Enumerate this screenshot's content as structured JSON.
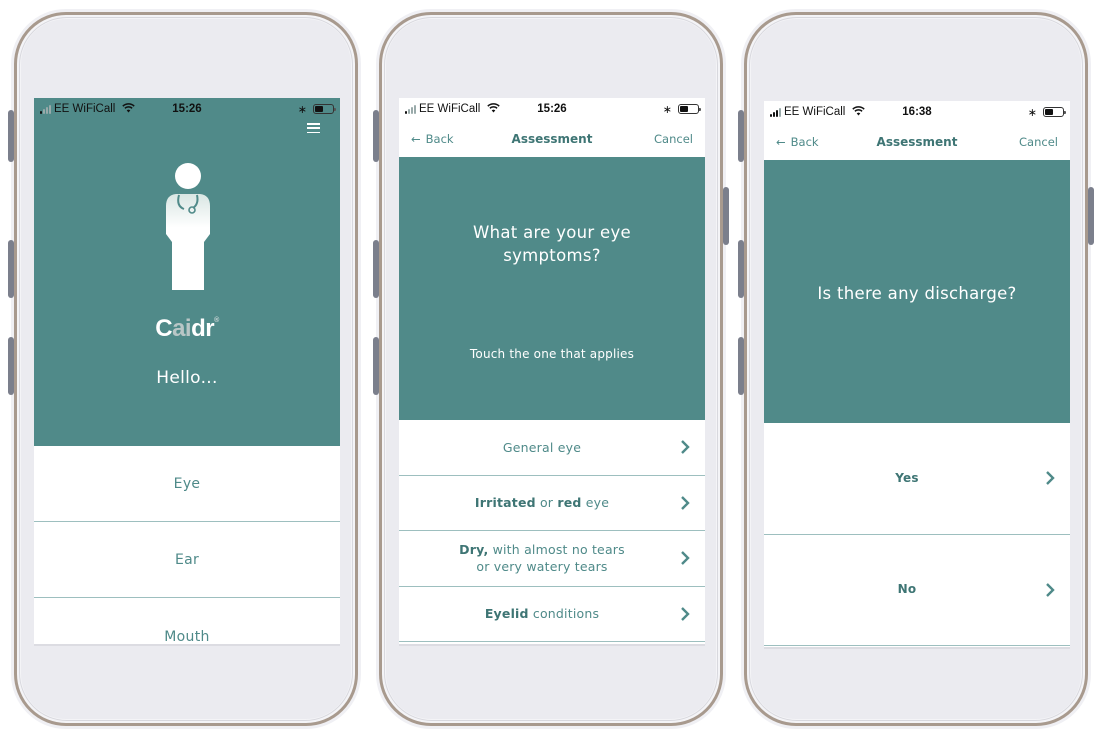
{
  "colors": {
    "teal": "#508a89",
    "teal_text": "#4f8a89",
    "divider": "#9dbfbf"
  },
  "phones": [
    {
      "status": {
        "carrier": "EE WiFiCall",
        "time": "15:26",
        "signal_bars_on": 1
      },
      "menu_icon": "hamburger-icon",
      "hero": {
        "illustration": "doctor-icon",
        "logo_prefix": "C",
        "logo_ai": "ai",
        "logo_suffix": "dr",
        "logo_mark": "®",
        "greeting": "Hello..."
      },
      "list": [
        {
          "label": "Eye"
        },
        {
          "label": "Ear"
        },
        {
          "label": "Mouth"
        }
      ]
    },
    {
      "status": {
        "carrier": "EE WiFiCall",
        "time": "15:26",
        "signal_bars_on": 1
      },
      "nav": {
        "back_arrow": "←",
        "back": "Back",
        "title": "Assessment",
        "cancel": "Cancel"
      },
      "question": {
        "title": "What are your eye symptoms?",
        "subtitle": "Touch the one that applies"
      },
      "options": [
        {
          "parts": [
            {
              "t": "General eye",
              "b": false
            }
          ]
        },
        {
          "parts": [
            {
              "t": "Irritated",
              "b": true
            },
            {
              "t": " or ",
              "b": false
            },
            {
              "t": "red",
              "b": true
            },
            {
              "t": " eye",
              "b": false
            }
          ]
        },
        {
          "line1": [
            {
              "t": "Dry,",
              "b": true
            },
            {
              "t": " with almost no tears",
              "b": false
            }
          ],
          "line2": "or very watery tears"
        },
        {
          "parts": [
            {
              "t": "Eyelid",
              "b": true
            },
            {
              "t": " conditions",
              "b": false
            }
          ]
        }
      ]
    },
    {
      "status": {
        "carrier": "EE WiFiCall",
        "time": "16:38",
        "signal_bars_on": 2
      },
      "nav": {
        "back_arrow": "←",
        "back": "Back",
        "title": "Assessment",
        "cancel": "Cancel"
      },
      "question": {
        "title": "Is there any discharge?"
      },
      "options": [
        {
          "label": "Yes"
        },
        {
          "label": "No"
        }
      ]
    }
  ]
}
